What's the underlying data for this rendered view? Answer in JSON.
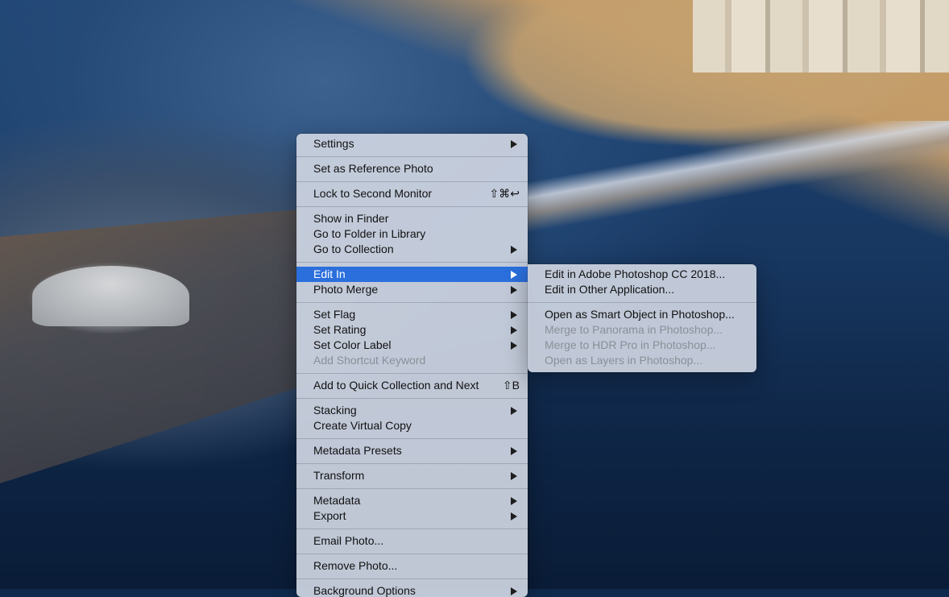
{
  "context_menu": {
    "items": [
      {
        "label": "Settings",
        "submenu": true
      },
      {
        "label": "Set as Reference Photo"
      },
      {
        "label": "Lock to Second Monitor",
        "shortcut": "⇧⌘↩"
      },
      {
        "label": "Show in Finder"
      },
      {
        "label": "Go to Folder in Library"
      },
      {
        "label": "Go to Collection",
        "submenu": true
      },
      {
        "label": "Edit In",
        "submenu": true,
        "highlighted": true
      },
      {
        "label": "Photo Merge",
        "submenu": true
      },
      {
        "label": "Set Flag",
        "submenu": true
      },
      {
        "label": "Set Rating",
        "submenu": true
      },
      {
        "label": "Set Color Label",
        "submenu": true
      },
      {
        "label": "Add Shortcut Keyword",
        "disabled": true
      },
      {
        "label": "Add to Quick Collection and Next",
        "shortcut": "⇧B"
      },
      {
        "label": "Stacking",
        "submenu": true
      },
      {
        "label": "Create Virtual Copy"
      },
      {
        "label": "Metadata Presets",
        "submenu": true
      },
      {
        "label": "Transform",
        "submenu": true
      },
      {
        "label": "Metadata",
        "submenu": true
      },
      {
        "label": "Export",
        "submenu": true
      },
      {
        "label": "Email Photo..."
      },
      {
        "label": "Remove Photo..."
      },
      {
        "label": "Background Options",
        "submenu": true
      }
    ]
  },
  "edit_in_submenu": {
    "items": [
      {
        "label": "Edit in Adobe Photoshop CC 2018..."
      },
      {
        "label": "Edit in Other Application..."
      },
      {
        "label": "Open as Smart Object in Photoshop..."
      },
      {
        "label": "Merge to Panorama in Photoshop...",
        "disabled": true
      },
      {
        "label": "Merge to HDR Pro in Photoshop...",
        "disabled": true
      },
      {
        "label": "Open as Layers in Photoshop...",
        "disabled": true
      }
    ]
  },
  "colors": {
    "highlight": "#2b6fdc",
    "menu_background": "#cdd4e1",
    "disabled_text": "#8a8f98"
  }
}
